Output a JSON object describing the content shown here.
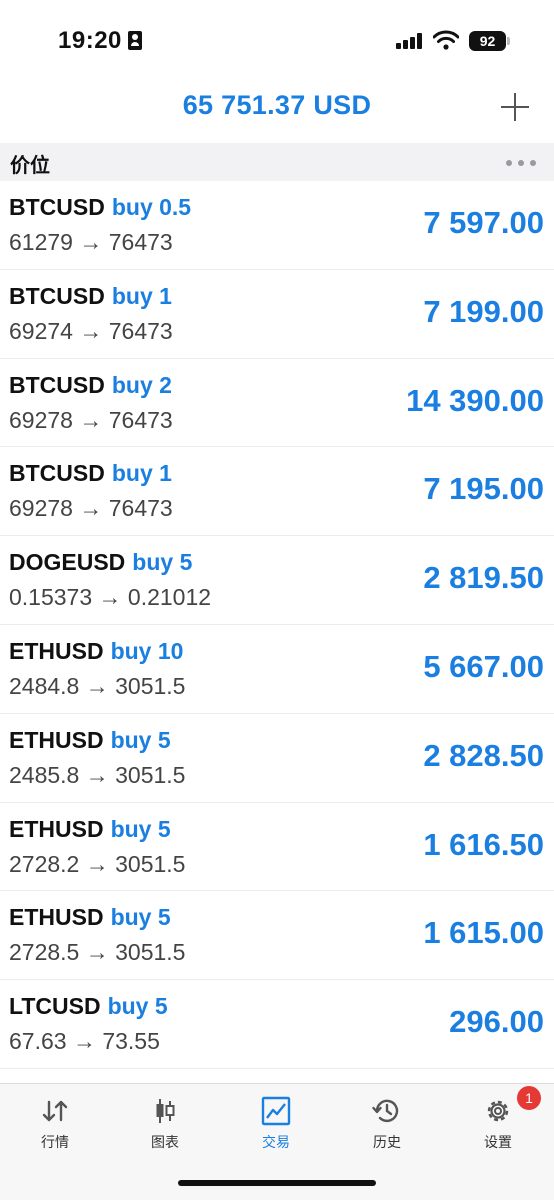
{
  "status_bar": {
    "time": "19:20",
    "battery": "92"
  },
  "header": {
    "balance": "65 751.37 USD",
    "add_icon": "plus-icon"
  },
  "section": {
    "title": "价位",
    "more_icon": "more-dots-icon"
  },
  "positions": [
    {
      "symbol": "BTCUSD",
      "side": "buy 0.5",
      "prices": "61279 → 76473",
      "profit": "7 597.00"
    },
    {
      "symbol": "BTCUSD",
      "side": "buy 1",
      "prices": "69274 → 76473",
      "profit": "7 199.00"
    },
    {
      "symbol": "BTCUSD",
      "side": "buy 2",
      "prices": "69278 → 76473",
      "profit": "14 390.00"
    },
    {
      "symbol": "BTCUSD",
      "side": "buy 1",
      "prices": "69278 → 76473",
      "profit": "7 195.00"
    },
    {
      "symbol": "DOGEUSD",
      "side": "buy 5",
      "prices": "0.15373 → 0.21012",
      "profit": "2 819.50"
    },
    {
      "symbol": "ETHUSD",
      "side": "buy 10",
      "prices": "2484.8 → 3051.5",
      "profit": "5 667.00"
    },
    {
      "symbol": "ETHUSD",
      "side": "buy 5",
      "prices": "2485.8 → 3051.5",
      "profit": "2 828.50"
    },
    {
      "symbol": "ETHUSD",
      "side": "buy 5",
      "prices": "2728.2 → 3051.5",
      "profit": "1 616.50"
    },
    {
      "symbol": "ETHUSD",
      "side": "buy 5",
      "prices": "2728.5 → 3051.5",
      "profit": "1 615.00"
    },
    {
      "symbol": "LTCUSD",
      "side": "buy 5",
      "prices": "67.63 → 73.55",
      "profit": "296.00"
    }
  ],
  "tabs": [
    {
      "label": "行情",
      "icon": "quotes-arrows-icon",
      "active": false
    },
    {
      "label": "图表",
      "icon": "candlestick-chart-icon",
      "active": false
    },
    {
      "label": "交易",
      "icon": "trade-chart-icon",
      "active": true
    },
    {
      "label": "历史",
      "icon": "history-clock-icon",
      "active": false
    },
    {
      "label": "设置",
      "icon": "settings-gear-icon",
      "active": false,
      "badge": "1"
    }
  ],
  "colors": {
    "accent": "#1a7fe0",
    "badge": "#e53935"
  }
}
